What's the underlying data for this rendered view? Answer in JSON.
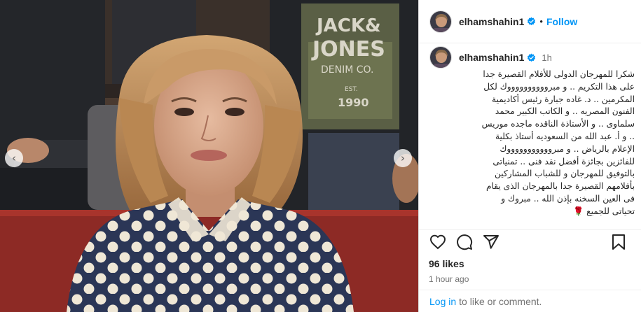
{
  "post": {
    "username": "elhamshahin1",
    "follow_label": "Follow",
    "separator": "•",
    "caption_time": "1h",
    "caption_lines": [
      "شكرا للمهرجان الدولى للأفلام القصيرة جدا",
      "على هذا التكريم .. و مبرووووووووووك لكل",
      "المكرمين .. د. غاده جبارة رئيس أكاديمية",
      "الفنون المصريه .. و الكاتب الكبير محمد",
      "سلماوى .. و الأستاذة الناقده ماجده موريس",
      ".. و أ. عبد الله من السعوديه أستاذ بكلية",
      "الإعلام بالرياض .. و مبروووووووووووك",
      "للفائزين بجائزة أفضل نقد فنى .. تمنياتى",
      "بالتوفيق للمهرجان و للشباب المشاركين",
      "بأفلامهم القصيرة جدا  بالمهرجان الذى يقام",
      "فى العين السخنه بإذن الله .. مبروك و",
      "تحياتى للجميع 🌹"
    ],
    "likes": "96 likes",
    "time_ago": "1 hour ago",
    "login_link": "Log in",
    "login_rest": "to like or comment."
  },
  "media": {
    "shirt_print_line1": "JACK&",
    "shirt_print_line2": "JONES",
    "shirt_print_line3": "DENIM CO.",
    "shirt_print_line4": "EST.",
    "shirt_print_line5": "1990"
  },
  "icons": {
    "verified": "verified-badge-icon",
    "like": "heart-icon",
    "comment": "comment-icon",
    "share": "share-icon",
    "save": "bookmark-icon",
    "prev": "chevron-left-icon",
    "next": "chevron-right-icon"
  },
  "colors": {
    "link_blue": "#0095f6",
    "text_primary": "#262626",
    "text_secondary": "#737373"
  }
}
